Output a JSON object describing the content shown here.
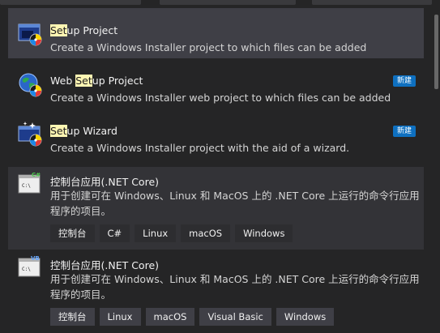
{
  "colors": {
    "background": "#252526",
    "selected_row": "#3f3f46",
    "hover_row": "#333337",
    "badge": "#0e70c0",
    "tag": "#3f3f46",
    "highlight": "#fff6b3"
  },
  "templates": [
    {
      "icon": "setup-project-icon",
      "title_highlight": "Set",
      "title_rest": "up Project",
      "description": "Create a Windows Installer project to which files can be added",
      "selected": true
    },
    {
      "icon": "web-setup-project-icon",
      "title_before": "Web ",
      "title_highlight": "Set",
      "title_rest": "up Project",
      "description": "Create a Windows Installer web project to which files can be added",
      "badge": "新建"
    },
    {
      "icon": "setup-wizard-icon",
      "title_highlight": "Set",
      "title_rest": "up Wizard",
      "description": "Create a Windows Installer project with the aid of a wizard.",
      "badge": "新建"
    },
    {
      "icon": "console-app-csharp-icon",
      "icon_lang": "C#",
      "icon_screen_text": "C:\\",
      "title": "控制台应用(.NET Core)",
      "description": "用于创建可在 Windows、Linux 和 MacOS 上的 .NET Core 上运行的命令行应用程序的项目。",
      "tags": [
        "控制台",
        "C#",
        "Linux",
        "macOS",
        "Windows"
      ]
    },
    {
      "icon": "console-app-vb-icon",
      "icon_lang": "VB",
      "icon_screen_text": "C:\\",
      "title": "控制台应用(.NET Core)",
      "description": "用于创建可在 Windows、Linux 和 MacOS 上的 .NET Core 上运行的命令行应用程序的项目。",
      "tags": [
        "控制台",
        "Linux",
        "macOS",
        "Visual Basic",
        "Windows"
      ]
    }
  ]
}
